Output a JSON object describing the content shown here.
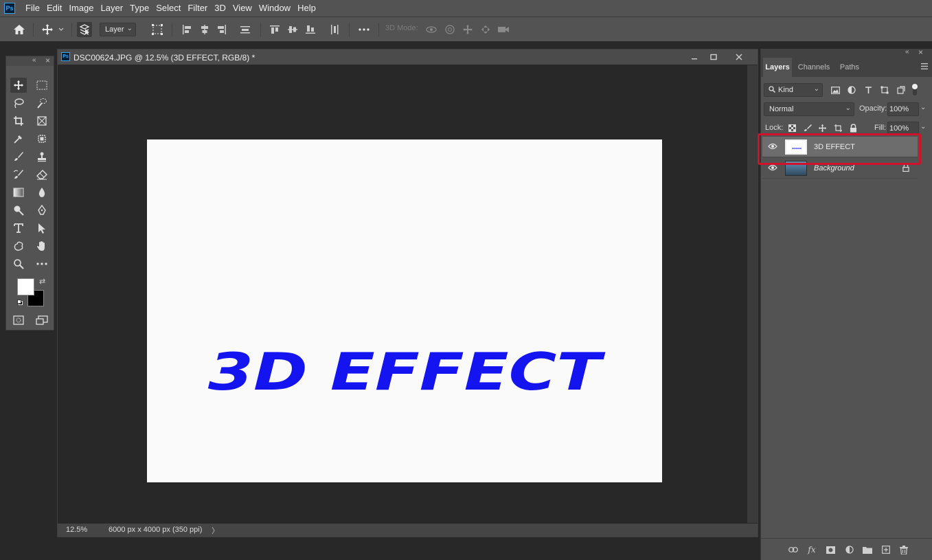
{
  "app": {
    "logo_text": "Ps",
    "menu": [
      "File",
      "Edit",
      "Image",
      "Layer",
      "Type",
      "Select",
      "Filter",
      "3D",
      "View",
      "Window",
      "Help"
    ]
  },
  "options_bar": {
    "auto_select_target": "Layer",
    "mode_3d_label": "3D Mode:"
  },
  "document": {
    "title": "DSC00624.JPG @ 12.5% (3D EFFECT, RGB/8) *",
    "artwork_text": "3D EFFECT",
    "artwork_color": "#1414f0",
    "canvas_color": "#fafafa",
    "status": {
      "zoom": "12.5%",
      "dimensions": "6000 px x 4000 px (350 ppi)",
      "arrow": "〉"
    }
  },
  "colors": {
    "foreground": "#ffffff",
    "background": "#000000",
    "highlight": "#d0122a"
  },
  "layers_panel": {
    "tabs": [
      "Layers",
      "Channels",
      "Paths"
    ],
    "active_tab": "Layers",
    "filter_kind": "Kind",
    "blend_mode": "Normal",
    "opacity_label": "Opacity:",
    "opacity_value": "100%",
    "lock_label": "Lock:",
    "fill_label": "Fill:",
    "fill_value": "100%",
    "layers": [
      {
        "name": "3D EFFECT",
        "selected": true,
        "locked": false
      },
      {
        "name": "Background",
        "selected": false,
        "locked": true
      }
    ]
  }
}
